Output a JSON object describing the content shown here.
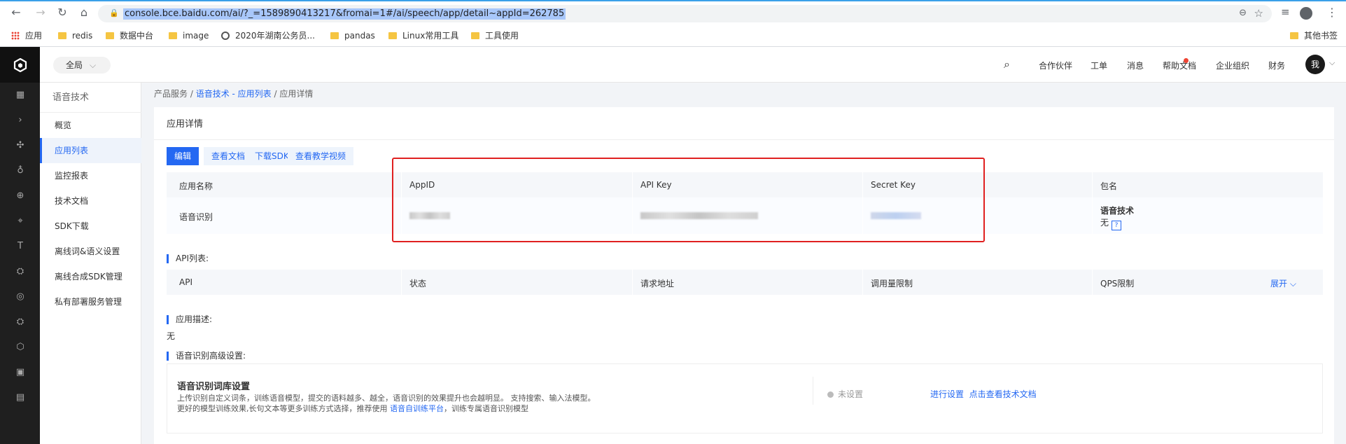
{
  "browser": {
    "url": "console.bce.baidu.com/ai/?_=1589890413217&fromai=1#/ai/speech/app/detail~appId=262785",
    "bookmarks": [
      "应用",
      "redis",
      "数据中台",
      "image",
      "2020年湖南公务员...",
      "pandas",
      "Linux常用工具",
      "工具使用"
    ],
    "other_bookmarks": "其他书签"
  },
  "topbar": {
    "scope": "全局",
    "links": [
      "合作伙伴",
      "工单",
      "消息",
      "帮助文档",
      "企业组织",
      "财务"
    ],
    "user": "我"
  },
  "sidemenu": {
    "title": "语音技术",
    "items": [
      "概览",
      "应用列表",
      "监控报表",
      "技术文档",
      "SDK下载",
      "离线词&语义设置",
      "离线合成SDK管理",
      "私有部署服务管理"
    ],
    "active_index": 1
  },
  "breadcrumb": {
    "root": "产品服务",
    "sep": "/",
    "link": "语音技术 - 应用列表",
    "current": "应用详情"
  },
  "card": {
    "title": "应用详情",
    "buttons": [
      "编辑",
      "查看文档",
      "下载SDK",
      "查看教学视频"
    ]
  },
  "app_table": {
    "headers": [
      "应用名称",
      "AppID",
      "API Key",
      "Secret Key",
      "包名"
    ],
    "row": {
      "name": "语音识别",
      "package_title": "语音技术",
      "package_value": "无",
      "help": "?"
    }
  },
  "api_list": {
    "label": "API列表:",
    "headers": [
      "API",
      "状态",
      "请求地址",
      "调用量限制",
      "QPS限制"
    ],
    "expand": "展开"
  },
  "description": {
    "label": "应用描述:",
    "value": "无"
  },
  "advanced": {
    "label": "语音识别高级设置:",
    "title": "语音识别词库设置",
    "line1": "上传识别自定义词条，训练语音模型，提交的语料越多、越全，语音识别的效果提升也会越明显。 支持搜索、输入法模型。",
    "line2_prefix": "更好的模型训练效果,长句文本等更多训练方式选择，推荐使用",
    "line2_link": "语音自训练平台",
    "line2_suffix": "，训练专属语音识别模型",
    "status": "未设置",
    "action1": "进行设置",
    "action2": "点击查看技术文档"
  }
}
